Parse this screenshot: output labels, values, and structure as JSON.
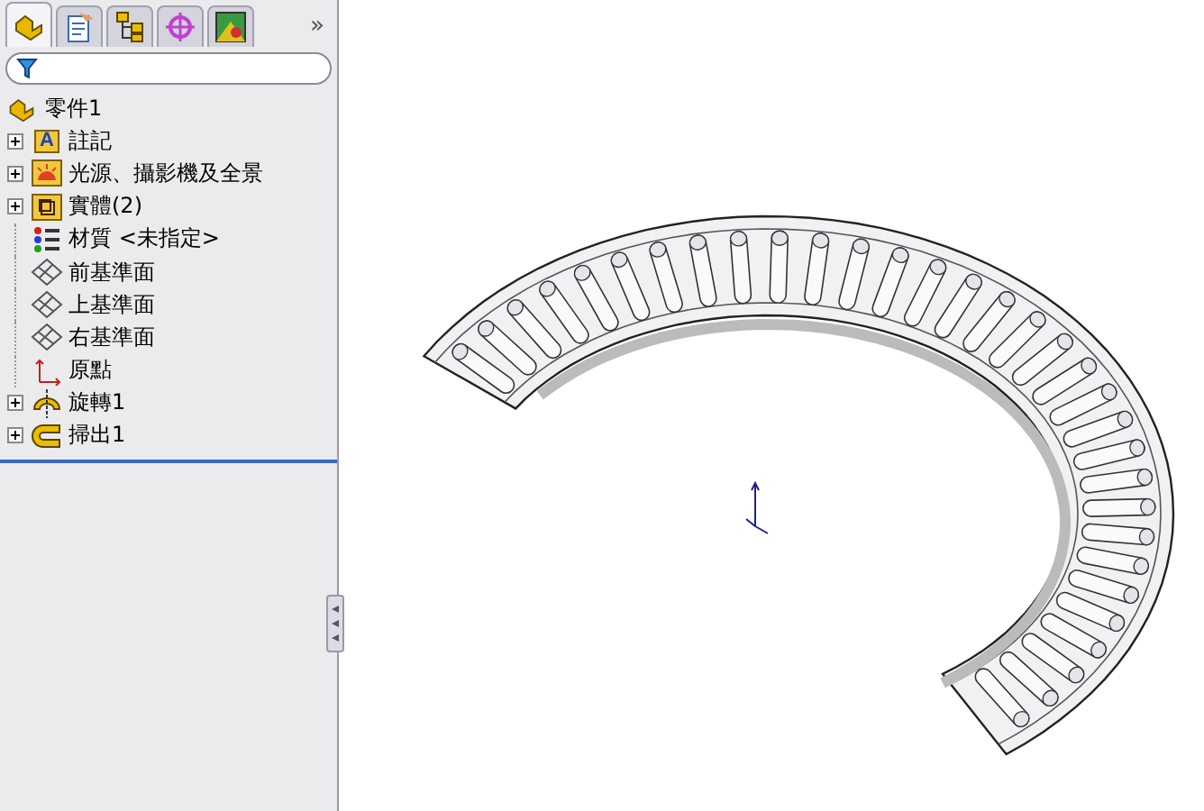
{
  "panel_tabs": [
    {
      "kind": "part",
      "selected": true
    },
    {
      "kind": "properties",
      "selected": false
    },
    {
      "kind": "config",
      "selected": false
    },
    {
      "kind": "target",
      "selected": false
    },
    {
      "kind": "display",
      "selected": false
    }
  ],
  "more_tabs": "»",
  "tree": {
    "root": {
      "label": "零件1",
      "kind": "part"
    },
    "children": [
      {
        "label": "註記",
        "kind": "annotation",
        "icon_text": "A",
        "expandable": true
      },
      {
        "label": "光源、攝影機及全景",
        "kind": "lights",
        "expandable": true
      },
      {
        "label": "實體(2)",
        "kind": "solid",
        "expandable": true
      },
      {
        "label": "材質 <未指定>",
        "kind": "material",
        "expandable": false
      },
      {
        "label": "前基準面",
        "kind": "plane",
        "expandable": false
      },
      {
        "label": "上基準面",
        "kind": "plane",
        "expandable": false
      },
      {
        "label": "右基準面",
        "kind": "plane",
        "expandable": false
      },
      {
        "label": "原點",
        "kind": "origin",
        "expandable": false
      },
      {
        "label": "旋轉1",
        "kind": "revolve",
        "expandable": true
      },
      {
        "label": "掃出1",
        "kind": "sweep",
        "expandable": true
      }
    ]
  }
}
